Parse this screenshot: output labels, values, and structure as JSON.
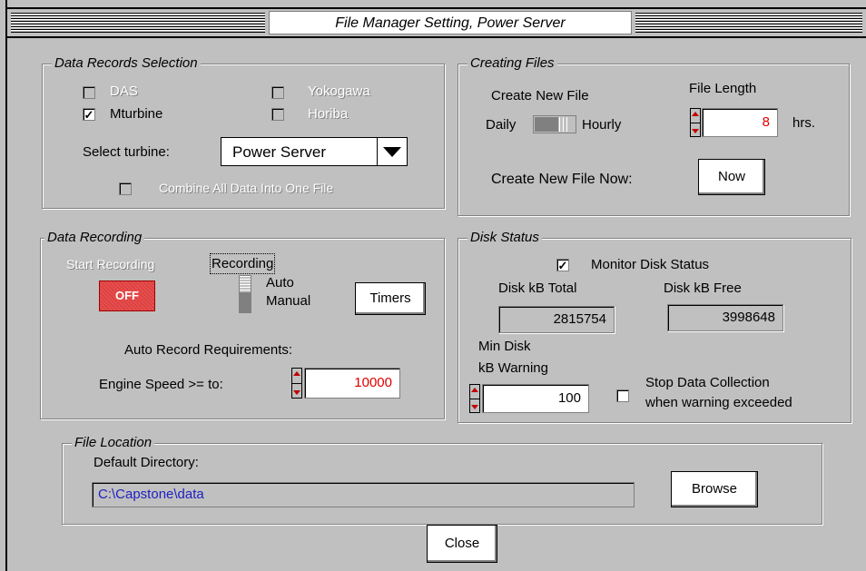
{
  "window": {
    "title": "File Manager Setting,  Power Server"
  },
  "data_records": {
    "legend": "Data Records Selection",
    "options": [
      {
        "label": "DAS",
        "checked": false,
        "enabled": false
      },
      {
        "label": "Yokogawa",
        "checked": false,
        "enabled": false
      },
      {
        "label": "Mturbine",
        "checked": true,
        "enabled": true
      },
      {
        "label": "Horiba",
        "checked": false,
        "enabled": false
      }
    ],
    "select_turbine_label": "Select turbine:",
    "select_turbine_value": "Power Server",
    "combine_label": "Combine All Data Into One File"
  },
  "creating_files": {
    "legend": "Creating Files",
    "create_new_file_label": "Create New File",
    "daily_label": "Daily",
    "hourly_label": "Hourly",
    "file_length_label": "File Length",
    "file_length_value": "8",
    "hrs_label": "hrs.",
    "now_label": "Create New File Now:",
    "now_button": "Now"
  },
  "data_recording": {
    "legend": "Data Recording",
    "start_recording_label": "Start Recording",
    "off_button": "OFF",
    "recording_label": "Recording",
    "auto_label": "Auto",
    "manual_label": "Manual",
    "timers_button": "Timers",
    "auto_record_req_label": "Auto Record Requirements:",
    "engine_speed_label": "Engine Speed >= to:",
    "engine_speed_value": "10000"
  },
  "disk_status": {
    "legend": "Disk Status",
    "monitor_label": "Monitor Disk Status",
    "monitor_checked": true,
    "total_label": "Disk kB Total",
    "total_value": "2815754",
    "free_label": "Disk kB Free",
    "free_value": "3998648",
    "min_disk_label1": "Min Disk",
    "min_disk_label2": "kB Warning",
    "min_value": "100",
    "stop_label1": "Stop Data Collection",
    "stop_label2": "when warning exceeded"
  },
  "file_location": {
    "legend": "File Location",
    "default_dir_label": "Default Directory:",
    "path": "C:\\Capstone\\data",
    "browse_button": "Browse"
  },
  "close_button": "Close",
  "colors": {
    "bg": "#c0c0c0",
    "off_red": "#e04040",
    "value_red": "#e00000",
    "path_blue": "#2020c0"
  }
}
